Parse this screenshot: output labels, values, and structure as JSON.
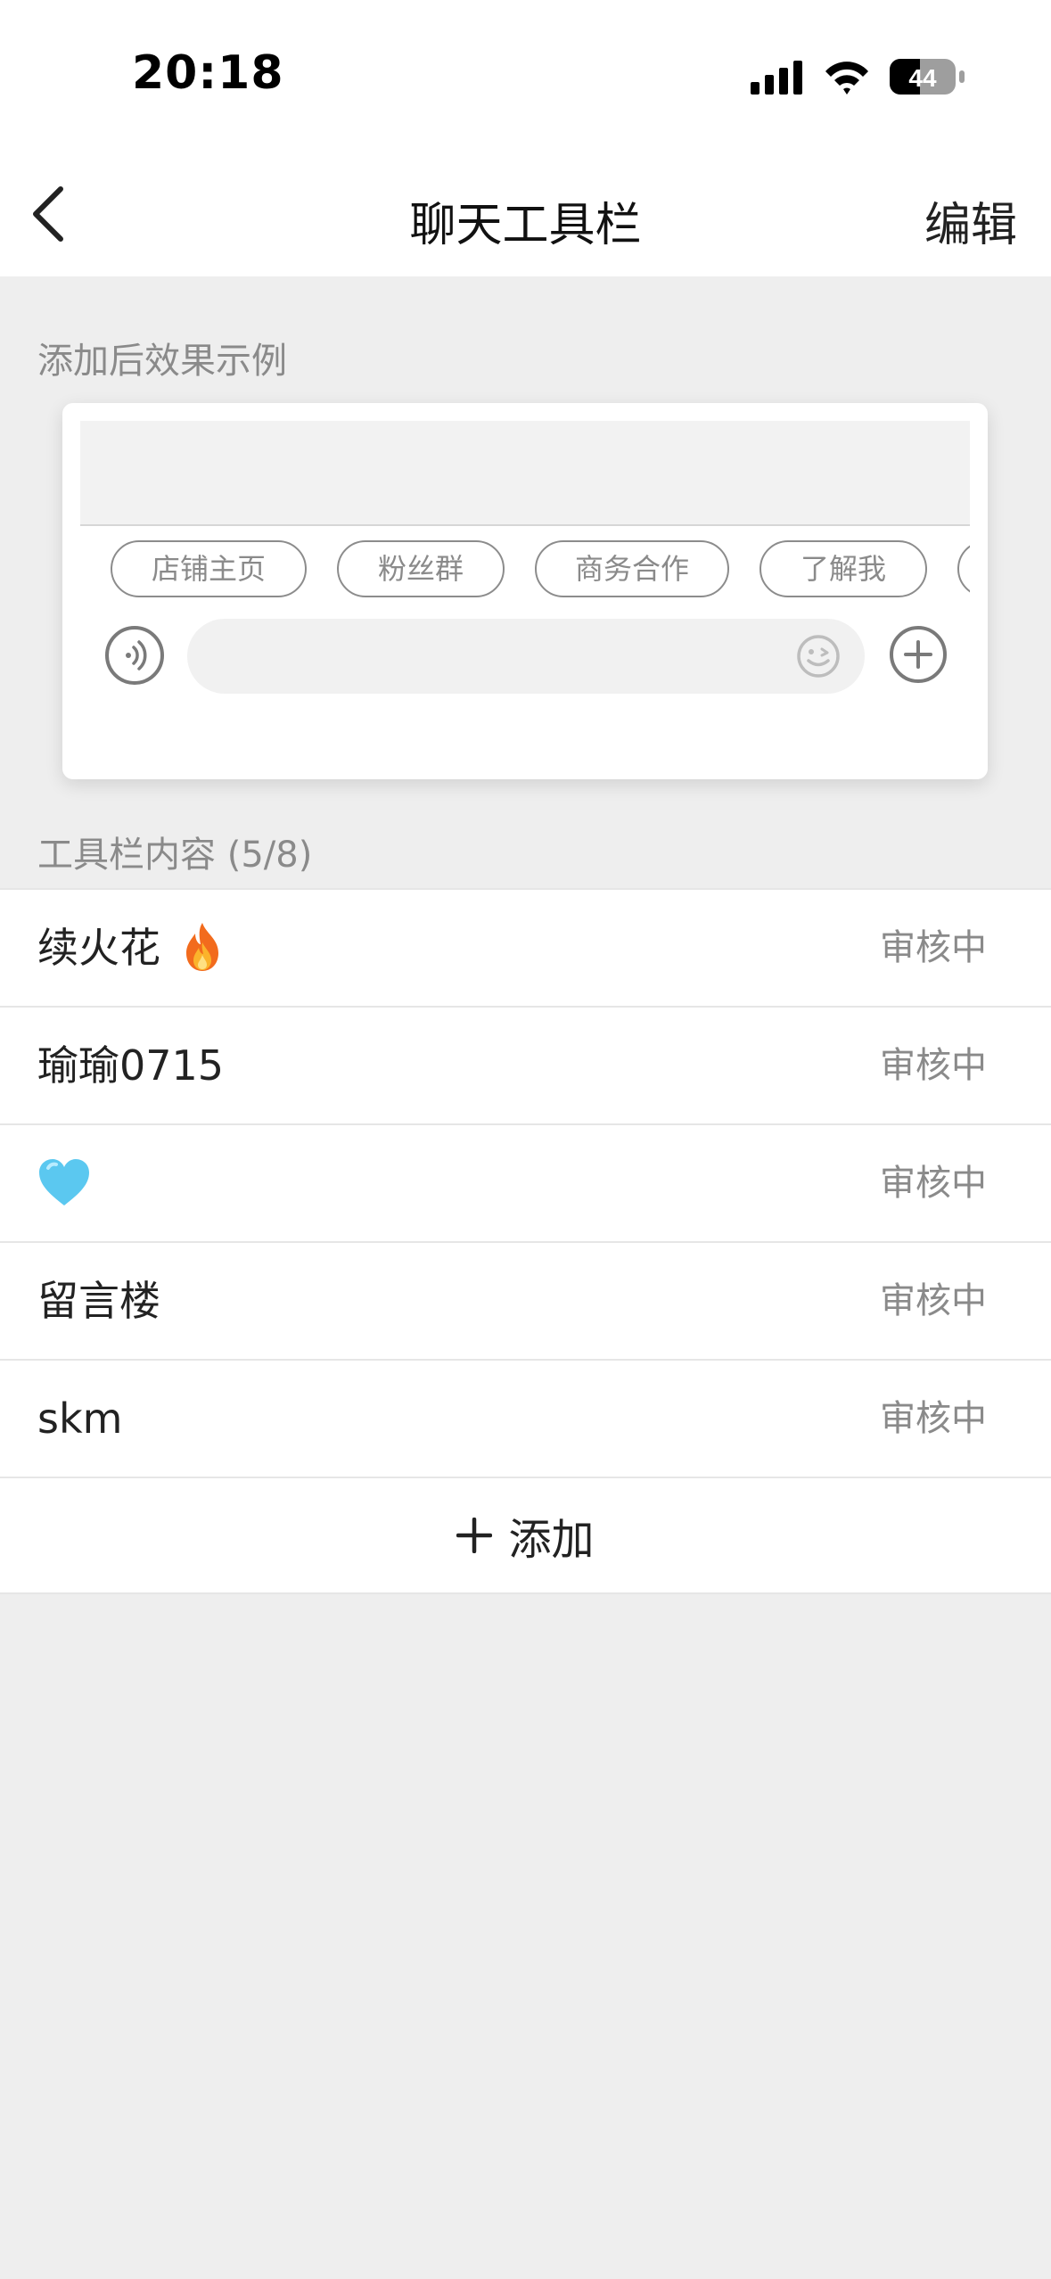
{
  "status_bar": {
    "time": "20:18",
    "battery": "44",
    "signal_icon": "cellular-signal-icon",
    "wifi_icon": "wifi-icon",
    "battery_icon": "battery-icon"
  },
  "nav": {
    "title": "聊天工具栏",
    "edit_label": "编辑",
    "back_icon": "chevron-left-icon"
  },
  "preview": {
    "section_label": "添加后效果示例",
    "chips": [
      "店铺主页",
      "粉丝群",
      "商务合作",
      "了解我"
    ],
    "voice_icon": "voice-icon",
    "emoji_icon": "emoji-icon",
    "plus_icon": "plus-circle-icon"
  },
  "toolbar": {
    "section_label": "工具栏内容 (5/8)",
    "items": [
      {
        "name": "续火花",
        "emoji": "fire-emoji",
        "status": "审核中"
      },
      {
        "name": "瑜瑜0715",
        "status": "审核中"
      },
      {
        "name": "",
        "emoji": "light-blue-heart-emoji",
        "status": "审核中"
      },
      {
        "name": "留言楼",
        "status": "审核中"
      },
      {
        "name": "skm",
        "status": "审核中"
      }
    ],
    "add_label": "添加"
  },
  "colors": {
    "background": "#eeeeee",
    "card": "#ffffff",
    "secondary_text": "#8a8a8a",
    "primary_text": "#222222"
  }
}
